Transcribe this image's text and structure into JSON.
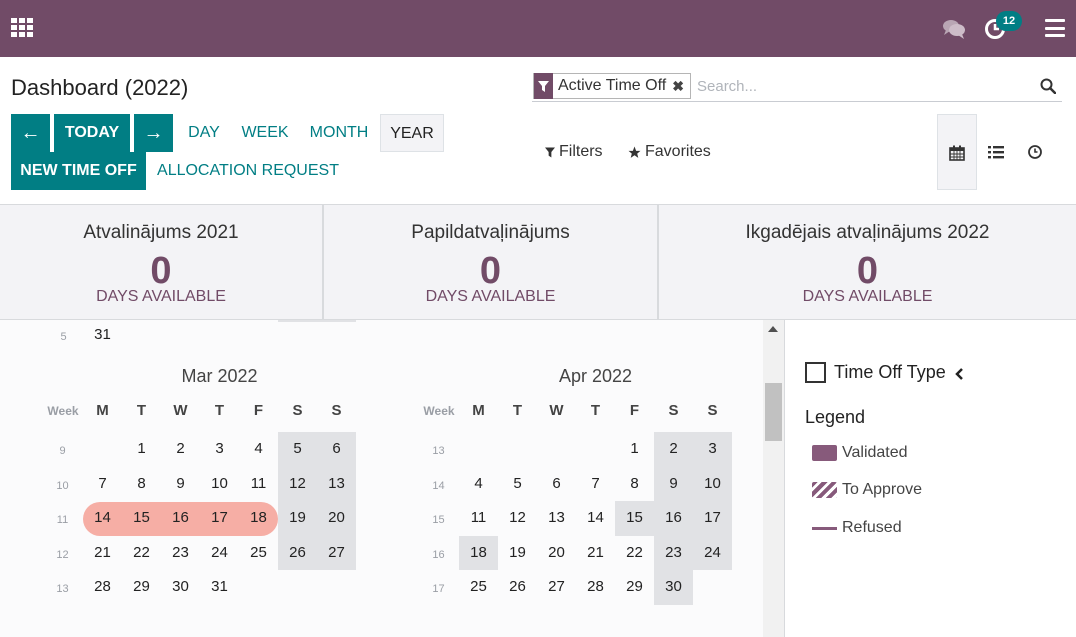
{
  "topbar": {
    "activity_count": "12",
    "icons": [
      "apps-grid-icon",
      "chat-icon",
      "clock-activity-icon",
      "hamburger-menu-icon"
    ]
  },
  "control_panel": {
    "title": "Dashboard (2022)",
    "buttons": {
      "prev": "←",
      "today": "TODAY",
      "next": "→",
      "day": "DAY",
      "week": "WEEK",
      "month": "MONTH",
      "year": "YEAR",
      "new_time_off": "NEW TIME OFF",
      "allocation_request": "ALLOCATION REQUEST"
    },
    "search": {
      "facet_label": "Active Time Off",
      "facet_remove": "✖",
      "placeholder": "Search..."
    },
    "filters_label": "Filters",
    "favorites_label": "Favorites",
    "active_view": "calendar"
  },
  "summary_cards": [
    {
      "title": "Atvalinājums 2021",
      "value": "0",
      "unit": "DAYS AVAILABLE"
    },
    {
      "title": "Papildatvaļinājums",
      "value": "0",
      "unit": "DAYS AVAILABLE"
    },
    {
      "title": "Ikgadējais atvaļinājums 2022",
      "value": "0",
      "unit": "DAYS AVAILABLE"
    }
  ],
  "calendar": {
    "week_header": "Week",
    "day_headers": [
      "M",
      "T",
      "W",
      "T",
      "F",
      "S",
      "S"
    ],
    "previous_tail": {
      "week": "5",
      "days": [
        "31"
      ]
    },
    "months": [
      {
        "title": "Mar 2022",
        "weeks": [
          {
            "week": "9",
            "days": [
              "",
              "1",
              "2",
              "3",
              "4",
              "5",
              "6"
            ]
          },
          {
            "week": "10",
            "days": [
              "7",
              "8",
              "9",
              "10",
              "11",
              "12",
              "13"
            ]
          },
          {
            "week": "11",
            "days": [
              "14",
              "15",
              "16",
              "17",
              "18",
              "19",
              "20"
            ]
          },
          {
            "week": "12",
            "days": [
              "21",
              "22",
              "23",
              "24",
              "25",
              "26",
              "27"
            ]
          },
          {
            "week": "13",
            "days": [
              "28",
              "29",
              "30",
              "31",
              "",
              "",
              ""
            ]
          }
        ],
        "leave_days": [
          "14",
          "15",
          "16",
          "17",
          "18"
        ],
        "leave_color": "#f6aea5"
      },
      {
        "title": "Apr 2022",
        "weeks": [
          {
            "week": "13",
            "days": [
              "",
              "",
              "",
              "",
              "1",
              "2",
              "3"
            ]
          },
          {
            "week": "14",
            "days": [
              "4",
              "5",
              "6",
              "7",
              "8",
              "9",
              "10"
            ]
          },
          {
            "week": "15",
            "days": [
              "11",
              "12",
              "13",
              "14",
              "15",
              "16",
              "17"
            ]
          },
          {
            "week": "16",
            "days": [
              "18",
              "19",
              "20",
              "21",
              "22",
              "23",
              "24"
            ]
          },
          {
            "week": "17",
            "days": [
              "25",
              "26",
              "27",
              "28",
              "29",
              "30",
              ""
            ]
          }
        ],
        "holidays": [
          "15",
          "18"
        ]
      }
    ]
  },
  "sidebar": {
    "time_off_type_label": "Time Off Type",
    "legend_title": "Legend",
    "legend": [
      {
        "label": "Validated",
        "style": "solid"
      },
      {
        "label": "To Approve",
        "style": "striped"
      },
      {
        "label": "Refused",
        "style": "line"
      }
    ],
    "legend_color": "#875a7b"
  },
  "colors": {
    "brand": "#714b67",
    "primary": "#017e84",
    "weekend": "#e1e2e5"
  }
}
